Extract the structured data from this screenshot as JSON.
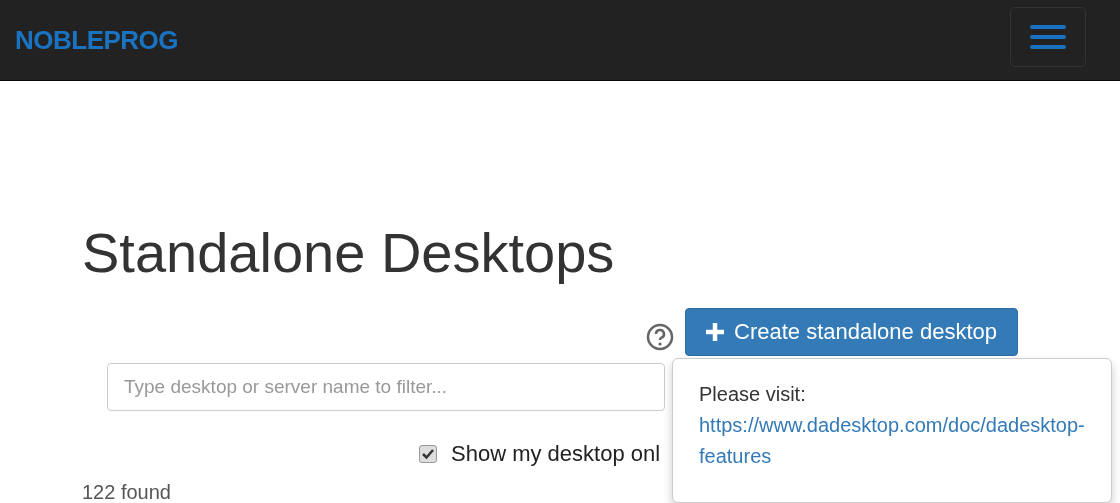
{
  "navbar": {
    "brand": "NOBLEPROG"
  },
  "page": {
    "title": "Standalone Desktops",
    "create_button": "Create standalone desktop",
    "search": {
      "placeholder": "Type desktop or server name to filter..."
    },
    "filter": {
      "label": "Show my desktop onl",
      "checked": true
    },
    "count": "122 found"
  },
  "popover": {
    "text": "Please visit:",
    "link": "https://www.dadesktop.com/doc/dadesktop-features"
  }
}
